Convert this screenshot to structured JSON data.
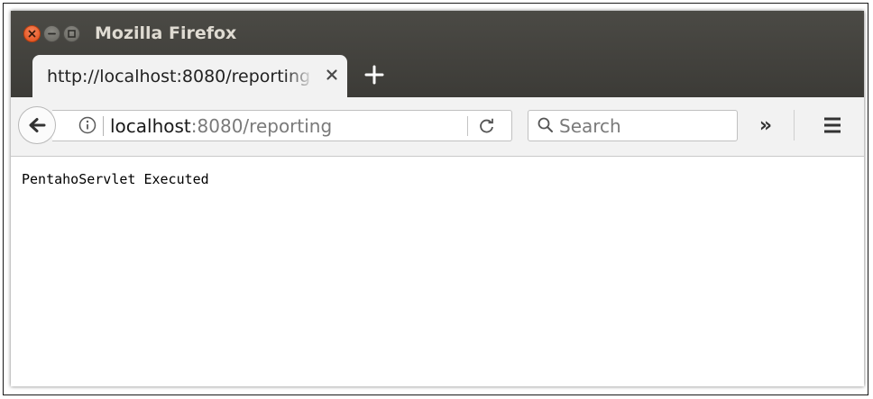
{
  "window": {
    "title": "Mozilla Firefox",
    "buttons": [
      "close-icon",
      "minimize-icon",
      "maximize-icon"
    ]
  },
  "tab": {
    "title": "http://localhost:8080/reporting",
    "close_icon": "close-icon",
    "new_tab_icon": "plus-icon"
  },
  "navbar": {
    "back_icon": "back-arrow-icon",
    "info_icon": "info-icon",
    "url_host": "localhost",
    "url_rest": ":8080/reporting",
    "reload_icon": "reload-icon",
    "search_placeholder": "Search",
    "search_icon": "search-icon",
    "overflow_label": "»",
    "menu_icon": "hamburger-menu-icon"
  },
  "page": {
    "text": "PentahoServlet Executed"
  },
  "colors": {
    "titlebar": "#3c3b37",
    "close_button": "#df4a16",
    "toolbar": "#f2f2f2"
  }
}
